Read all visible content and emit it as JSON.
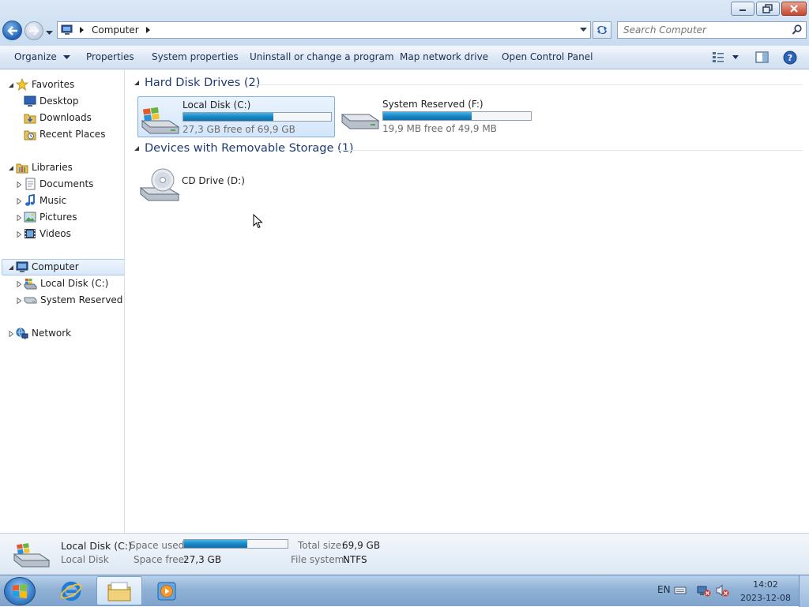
{
  "window": {
    "controls": {
      "minimize": "minimize",
      "maximize": "maximize",
      "close": "close"
    }
  },
  "address": {
    "crumb": "Computer",
    "search_placeholder": "Search Computer"
  },
  "toolbar": {
    "organize": "Organize",
    "properties": "Properties",
    "system_properties": "System properties",
    "uninstall": "Uninstall or change a program",
    "map_drive": "Map network drive",
    "control_panel": "Open Control Panel"
  },
  "nav": {
    "favorites": {
      "label": "Favorites",
      "items": [
        "Desktop",
        "Downloads",
        "Recent Places"
      ]
    },
    "libraries": {
      "label": "Libraries",
      "items": [
        "Documents",
        "Music",
        "Pictures",
        "Videos"
      ]
    },
    "computer": {
      "label": "Computer",
      "items": [
        "Local Disk (C:)",
        "System Reserved (F:)"
      ]
    },
    "network": {
      "label": "Network"
    }
  },
  "content": {
    "hdd_group": "Hard Disk Drives (2)",
    "removable_group": "Devices with Removable Storage (1)",
    "drives": [
      {
        "name": "Local Disk (C:)",
        "free": "27,3 GB free of 69,9 GB",
        "used_fraction": 0.61
      },
      {
        "name": "System Reserved (F:)",
        "free": "19,9 MB free of 49,9 MB",
        "used_fraction": 0.6
      }
    ],
    "cd": {
      "name": "CD Drive (D:)"
    }
  },
  "details": {
    "name": "Local Disk (C:)",
    "type": "Local Disk",
    "space_used_label": "Space used:",
    "space_free_label": "Space free:",
    "space_free": "27,3 GB",
    "total_size_label": "Total size:",
    "total_size": "69,9 GB",
    "fs_label": "File system:",
    "fs": "NTFS",
    "used_fraction": 0.61
  },
  "taskbar": {
    "lang": "EN",
    "time": "14:02",
    "date": "2023-12-08"
  },
  "colors": {
    "bar_fill": "#1b86c5",
    "group_header": "#1e3b78",
    "selection": "#d4e6fb"
  }
}
